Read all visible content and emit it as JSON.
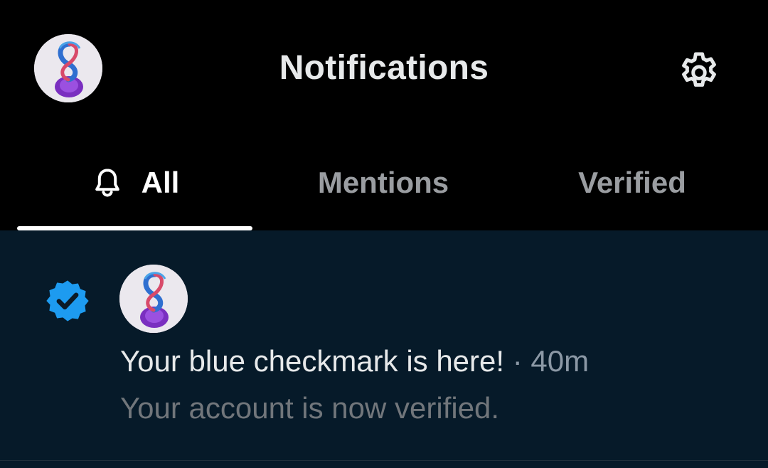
{
  "header": {
    "title": "Notifications",
    "avatar_icon": "profile-avatar",
    "settings_icon": "gear-icon"
  },
  "tabs": [
    {
      "label": "All",
      "icon": "bell-icon",
      "selected": true
    },
    {
      "label": "Mentions",
      "selected": false
    },
    {
      "label": "Verified",
      "selected": false
    }
  ],
  "notification": {
    "type_icon": "verified-badge-icon",
    "headline": "Your blue checkmark is here!",
    "separator": "·",
    "time": "40m",
    "subtext": "Your account is now verified."
  },
  "colors": {
    "background": "#000000",
    "panel": "#061a29",
    "verified_blue": "#1d9bf0",
    "text_primary": "#e7e9ea",
    "text_secondary": "#71767b"
  }
}
